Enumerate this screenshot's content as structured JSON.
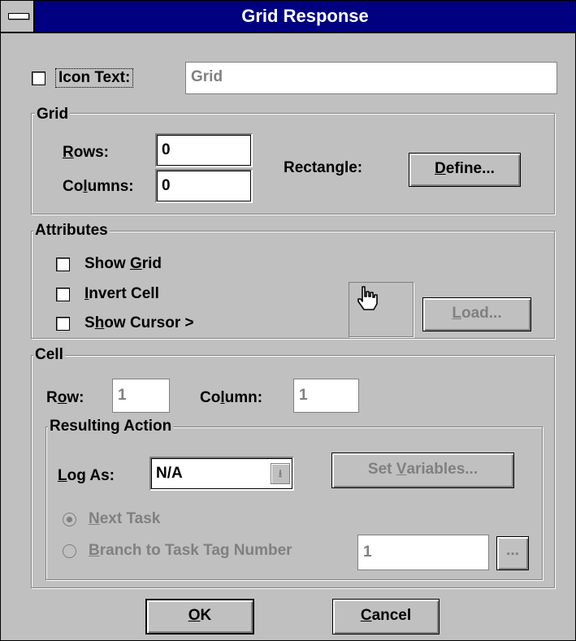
{
  "window": {
    "title": "Grid Response"
  },
  "icon_text": {
    "label": "Icon Text:",
    "value": "Grid"
  },
  "grid_group": {
    "title": "Grid",
    "rows_label": "Rows:",
    "rows_value": "0",
    "columns_label": "Columns:",
    "columns_value": "0",
    "rectangle_label": "Rectangle:",
    "define_button": "Define..."
  },
  "attributes_group": {
    "title": "Attributes",
    "show_grid": "Show Grid",
    "invert_cell": "Invert Cell",
    "show_cursor": "Show Cursor >",
    "load_button": "Load..."
  },
  "cell_group": {
    "title": "Cell",
    "row_label": "Row:",
    "row_value": "1",
    "column_label": "Column:",
    "column_value": "1",
    "resulting_action": {
      "title": "Resulting Action",
      "log_as_label": "Log As:",
      "log_as_value": "N/A",
      "set_variables_button": "Set Variables...",
      "next_task": "Next Task",
      "branch_label": "Branch to Task Tag Number",
      "branch_value": "1",
      "browse_button": "..."
    }
  },
  "buttons": {
    "ok": "OK",
    "cancel": "Cancel"
  }
}
